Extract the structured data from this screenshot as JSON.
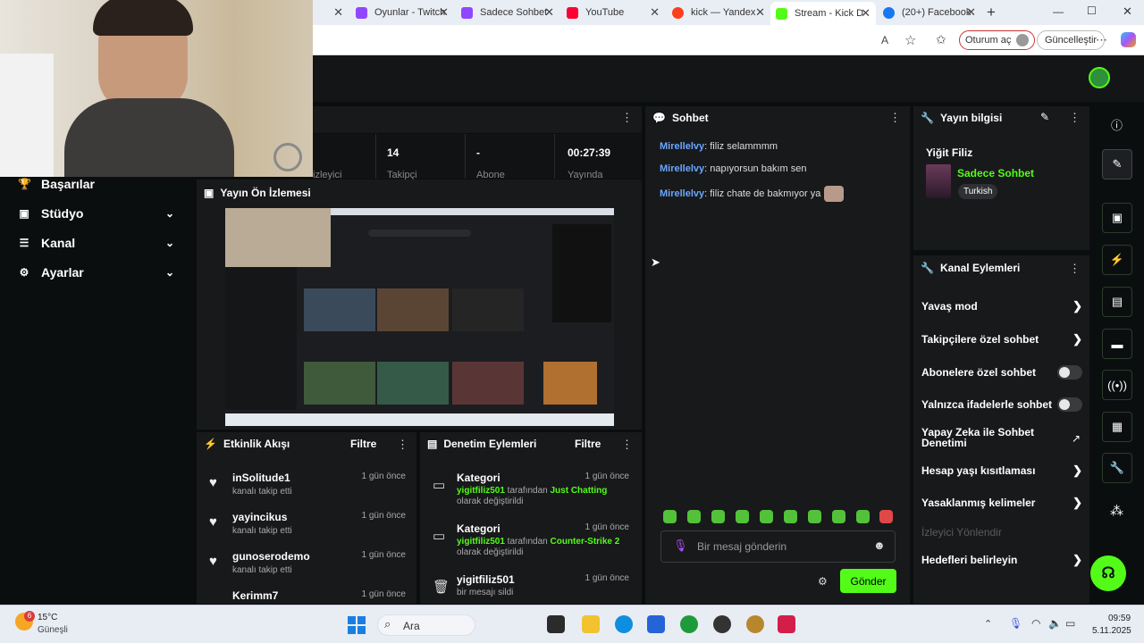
{
  "browser": {
    "tabs": [
      {
        "title": "Oyunlar - Twitch",
        "color": "#9146ff"
      },
      {
        "title": "Sadece Sohbet",
        "color": "#9146ff"
      },
      {
        "title": "YouTube",
        "color": "#ff0033"
      },
      {
        "title": "kick — Yandex",
        "color": "#fc3f1d"
      },
      {
        "title": "Stream - Kick D",
        "color": "#53fc18"
      },
      {
        "title": "(20+) Facebook",
        "color": "#1877f2"
      }
    ],
    "new_tab": "+",
    "signin_label": "Oturum aç",
    "update_label": "Güncelleştir"
  },
  "stats": [
    {
      "value": "14",
      "label": "Takipçi"
    },
    {
      "value": "-",
      "label": "Abone"
    },
    {
      "value": "00:27:39",
      "label": "Yayında"
    }
  ],
  "stats_partial_label": "izleyici",
  "sidebar": {
    "items": [
      {
        "label": "Başarılar",
        "icon": "trophy-icon",
        "chevron": false
      },
      {
        "label": "Stüdyo",
        "icon": "studio-icon",
        "chevron": true
      },
      {
        "label": "Kanal",
        "icon": "list-icon",
        "chevron": true
      },
      {
        "label": "Ayarlar",
        "icon": "gear-icon",
        "chevron": true
      }
    ]
  },
  "preview": {
    "title": "Yayın Ön İzlemesi"
  },
  "activity": {
    "title": "Etkinlik Akışı",
    "filter_label": "Filtre",
    "items": [
      {
        "name": "inSolitude1",
        "action": "kanalı takip etti",
        "time": "1 gün önce"
      },
      {
        "name": "yayincikus",
        "action": "kanalı takip etti",
        "time": "1 gün önce"
      },
      {
        "name": "gunoserodemo",
        "action": "kanalı takip etti",
        "time": "1 gün önce"
      },
      {
        "name": "Kerimm7",
        "action": "",
        "time": "1 gün önce"
      }
    ]
  },
  "moderation": {
    "title": "Denetim Eylemleri",
    "filter_label": "Filtre",
    "items": [
      {
        "title": "Kategori",
        "time": "1 gün önce",
        "user": "yigitfiliz501",
        "mid": " tarafından ",
        "value": "Just Chatting",
        "line3": "olarak değiştirildi"
      },
      {
        "title": "Kategori",
        "time": "1 gün önce",
        "user": "yigitfiliz501",
        "mid": " tarafından ",
        "value": "Counter-Strike 2",
        "line3": "olarak değiştirildi"
      },
      {
        "title": "yigitfiliz501",
        "time": "1 gün önce",
        "user": "",
        "mid": "",
        "value": "",
        "line3": "bir mesajı sildi"
      }
    ]
  },
  "chat": {
    "title": "Sohbet",
    "messages": [
      {
        "user": "Mirellelvy",
        "text": ": filiz selammmm"
      },
      {
        "user": "Mirellelvy",
        "text": ": napıyorsun bakım sen"
      },
      {
        "user": "Mirellelvy",
        "text": ": filiz chate de bakmıyor ya"
      }
    ],
    "input_placeholder": "Bir mesaj gönderin",
    "send_label": "Gönder"
  },
  "stream_info": {
    "title": "Yayın bilgisi",
    "streamer": "Yiğit Filiz",
    "category": "Sadece Sohbet",
    "language": "Turkish"
  },
  "channel_actions": {
    "title": "Kanal Eylemleri",
    "items": [
      {
        "label": "Yavaş mod",
        "control": "arrow"
      },
      {
        "label": "Takipçilere özel sohbet",
        "control": "arrow"
      },
      {
        "label": "Abonelere özel sohbet",
        "control": "toggle"
      },
      {
        "label": "Yalnızca ifadelerle sohbet",
        "control": "toggle"
      },
      {
        "label": "Yapay Zeka ile Sohbet Denetimi",
        "control": "external"
      },
      {
        "label": "Hesap yaşı kısıtlaması",
        "control": "arrow"
      },
      {
        "label": "Yasaklanmış kelimeler",
        "control": "arrow"
      },
      {
        "label": "İzleyici Yönlendir",
        "control": "none",
        "disabled": true
      },
      {
        "label": "Hedefleri belirleyin",
        "control": "arrow"
      }
    ]
  },
  "taskbar": {
    "weather_temp": "15°C",
    "weather_desc": "Güneşli",
    "weather_badge": "6",
    "search_label": "Ara",
    "time": "09:59",
    "date": "5.11.2025"
  },
  "colors": {
    "accent": "#53fc18",
    "panel": "#18191b",
    "background": "#0b0e0f"
  }
}
